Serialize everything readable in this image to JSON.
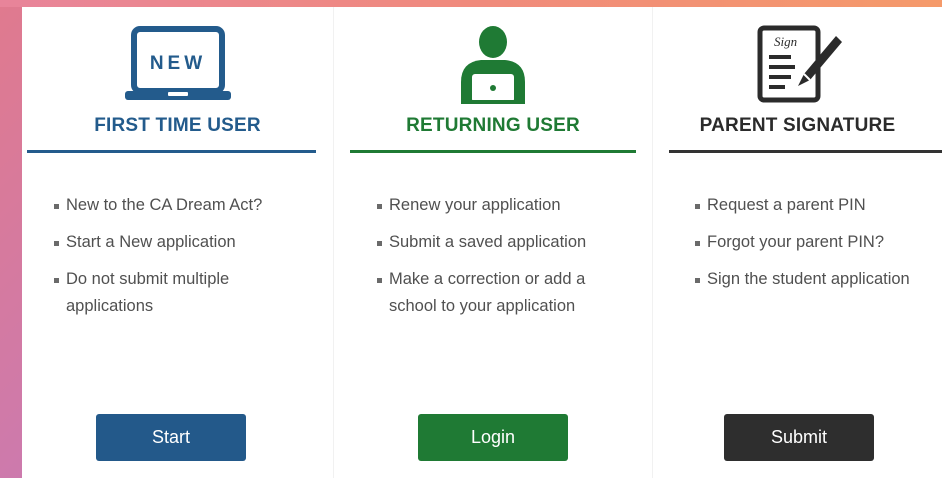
{
  "cards": [
    {
      "title": "FIRST TIME USER",
      "icon": "laptop-new-icon",
      "icon_text": "NEW",
      "color": "#235b8c",
      "items": [
        "New to the CA Dream Act?",
        "Start a New application",
        "Do not submit multiple applications"
      ],
      "button_label": "Start"
    },
    {
      "title": "RETURNING USER",
      "icon": "person-laptop-icon",
      "color": "#1f7a34",
      "items": [
        "Renew your application",
        "Submit a saved application",
        "Make a correction or add a school to your application"
      ],
      "button_label": "Login"
    },
    {
      "title": "PARENT SIGNATURE",
      "icon": "sign-document-pen-icon",
      "icon_text": "Sign",
      "color": "#2b2b2b",
      "items": [
        "Request a parent PIN",
        "Forgot your parent PIN?",
        "Sign the student application"
      ],
      "button_label": "Submit"
    }
  ]
}
